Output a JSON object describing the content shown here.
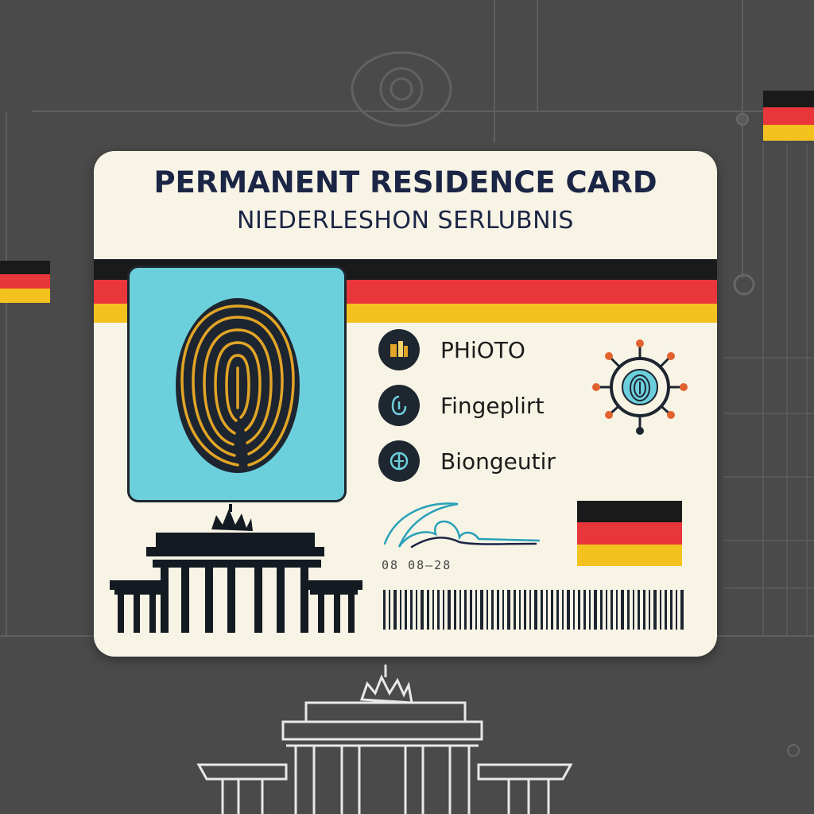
{
  "card": {
    "title": "PERMANENT RESIDENCE CARD",
    "subtitle": "NIEDERLESHON SERLUBNIS",
    "features": [
      {
        "label": "PHiOTO",
        "icon": "photo-icon"
      },
      {
        "label": "Fingeplirt",
        "icon": "fingerprint-icon"
      },
      {
        "label": "Biongeutir",
        "icon": "biometric-icon"
      }
    ],
    "date": "08  08–28"
  },
  "colors": {
    "background": "#4a4a4a",
    "card": "#f7f4e6",
    "flag_black": "#1a1a1a",
    "flag_red": "#e8363b",
    "flag_gold": "#f4c21e",
    "photo_bg": "#6cd0dc",
    "text_navy": "#1b2545"
  },
  "icons": [
    "eye-emblem-icon",
    "fingerprint-icon",
    "network-fingerprint-icon",
    "brandenburg-gate-icon",
    "signature",
    "barcode"
  ]
}
